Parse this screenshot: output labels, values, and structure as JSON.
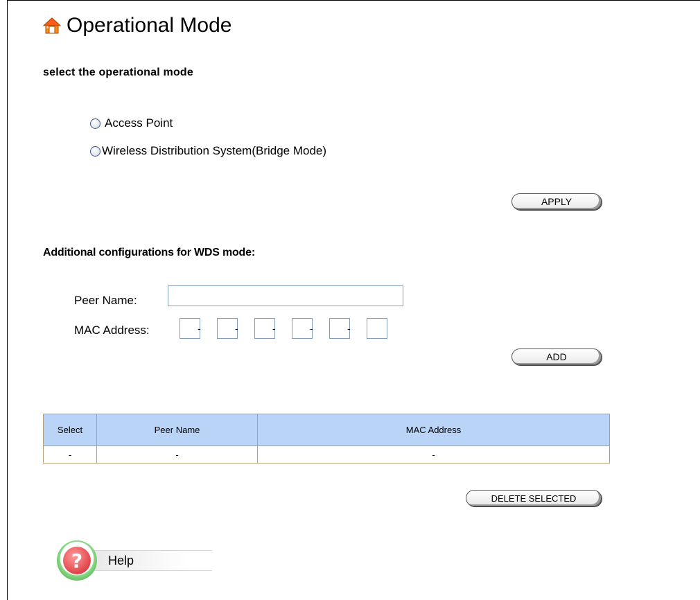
{
  "page": {
    "title": "Operational Mode",
    "subtitle": "select the operational mode"
  },
  "modes": {
    "options": [
      {
        "label": "Access Point",
        "selected": false
      },
      {
        "label": "Wireless Distribution System(Bridge Mode)",
        "selected": false
      }
    ],
    "apply_label": "APPLY"
  },
  "wds": {
    "heading": "Additional configurations for WDS mode:",
    "peer_name_label": "Peer Name:",
    "peer_name_value": "",
    "mac_label": "MAC Address:",
    "mac_separator": "-",
    "add_label": "ADD"
  },
  "table": {
    "headers": [
      "Select",
      "Peer Name",
      "MAC Address"
    ],
    "rows": [
      [
        "-",
        "-",
        "-"
      ]
    ],
    "header_color": "#b9d4f7"
  },
  "delete_label": "DELETE SELECTED",
  "help": {
    "icon": "question-icon",
    "label": "Help"
  },
  "icons": {
    "title_icon": "home-icon"
  }
}
